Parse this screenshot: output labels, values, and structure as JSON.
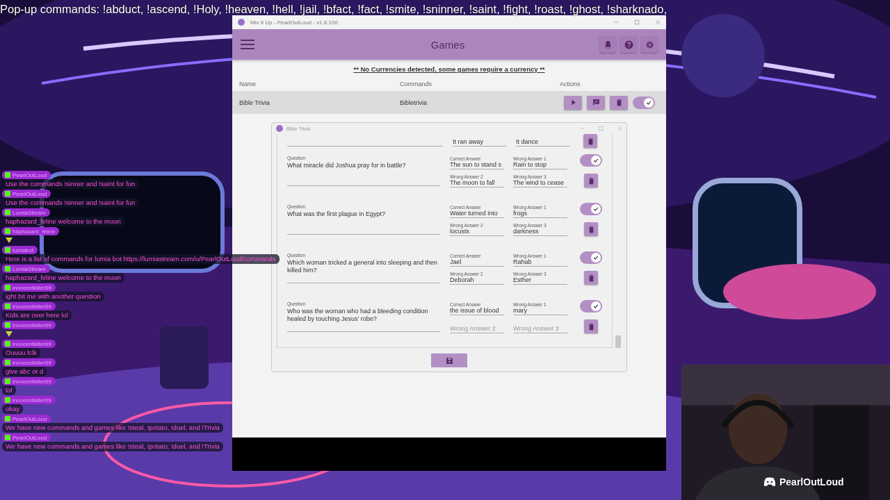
{
  "ticker": "Pop-up commands: !abduct, !ascend, !Holy, !heaven, !hell,  !jail, !bfact, !fact, !smite, !sninner, !saint, !fight, !roast, !ghost, !sharknado,",
  "chat": [
    {
      "user": "PearlOutLoud",
      "text": "Use the commands !sinner and !saint for fun"
    },
    {
      "user": "PearlOutLoud",
      "text": "Use the commands !sinner and !saint for fun"
    },
    {
      "user": "LumiaStream",
      "text": "haphazard_feline welcome to the moon"
    },
    {
      "user": "haphazard_feline",
      "kind": "emote"
    },
    {
      "user": "lumiabot",
      "text": "Here is a list of commands for lumia bot https://lumiastream.com/u/PearlOutLoud/commands"
    },
    {
      "user": "LumiaStream",
      "text": "haphazard_feline welcome to the moon"
    },
    {
      "user": "innocentkiller69",
      "text": "ight bit me with another question"
    },
    {
      "user": "innocentkiller69",
      "text": "Kids are over here lol"
    },
    {
      "user": "innocentkiller69",
      "kind": "emote"
    },
    {
      "user": "innocentkiller69",
      "text": "Ouuuu lclk"
    },
    {
      "user": "innocentkiller69",
      "text": "give abc or d"
    },
    {
      "user": "innocentkiller69",
      "text": "lol"
    },
    {
      "user": "innocentkiller69",
      "text": "okay"
    },
    {
      "user": "PearlOutLoud",
      "text": "We have new commands and games like !steal, !potato, !duel, and !Trivia"
    },
    {
      "user": "PearlOutLoud",
      "text": "We have new commands and games like !steal, !potato, !duel, and !Trivia"
    }
  ],
  "window": {
    "title": "Mix It Up - PearlOutLoud - v1.8.100",
    "page_title": "Games"
  },
  "notice": "** No Currencies detected, some games require a currency **",
  "games": {
    "columns": [
      "Name",
      "Commands",
      "Actions"
    ],
    "rows": [
      {
        "name": "Bible Trivia",
        "command": "Bibletrivia",
        "enabled": true
      }
    ]
  },
  "dialog": {
    "title": "Bible Trivia",
    "questions": [
      {
        "kind": "partial",
        "fields": [
          {
            "value": "It ran away"
          },
          {
            "value": "It dance"
          }
        ]
      },
      {
        "kind": "full",
        "question_label": "Question",
        "question": "What miracle did Joshua pray for in battle?",
        "enabled": true,
        "fields": [
          {
            "label": "Correct Answer",
            "value": "The sun to stand s"
          },
          {
            "label": "Wrong Answer 1",
            "value": "Rain to stop"
          },
          {
            "label": "Wrong Answer 2",
            "value": "The moon to fall"
          },
          {
            "label": "Wrong Answer 3",
            "value": "The wind to cease"
          }
        ]
      },
      {
        "kind": "full",
        "question_label": "Question",
        "question": "What was the first plague in Egypt?",
        "enabled": true,
        "fields": [
          {
            "label": "Correct Answer",
            "value": "Water turned into"
          },
          {
            "label": "Wrong Answer 1",
            "value": "frogs"
          },
          {
            "label": "Wrong Answer 2",
            "value": "locusts"
          },
          {
            "label": "Wrong Answer 3",
            "value": "darkness"
          }
        ]
      },
      {
        "kind": "full",
        "question_label": "Question",
        "question": "Which woman tricked a general into sleeping and then killed him?",
        "enabled": true,
        "fields": [
          {
            "label": "Correct Answer",
            "value": "Jael"
          },
          {
            "label": "Wrong Answer 1",
            "value": "Rahab"
          },
          {
            "label": "Wrong Answer 2",
            "value": "Deborah"
          },
          {
            "label": "Wrong Answer 3",
            "value": "Esther"
          }
        ]
      },
      {
        "kind": "full",
        "question_label": "Question",
        "question": "Who was the woman who had a bleeding condition healed by touching Jesus' robe?",
        "enabled": true,
        "fields": [
          {
            "label": "Correct Answer",
            "value": "the issue of blood"
          },
          {
            "label": "Wrong Answer 1",
            "value": "mary"
          },
          {
            "placeholder": "Wrong Answer 2"
          },
          {
            "placeholder": "Wrong Answer 3"
          }
        ]
      }
    ]
  },
  "stream_name": "PearlOutLoud"
}
